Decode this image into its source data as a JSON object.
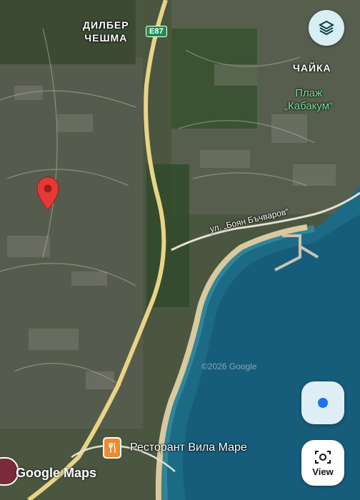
{
  "map": {
    "places": {
      "dilber_cheshma": "ДИЛБЕР\nЧЕШМА",
      "chaika": "ЧАЙКА",
      "beach_kabakum": "Плаж\n„Кабакум“"
    },
    "road_shield": "E87",
    "street": "ул. „Боян Бъчваров“",
    "poi": {
      "label": "Ресторант Вила Маре",
      "icon": "restaurant-icon"
    },
    "copyright": "©2026 Google",
    "logo": "Google Maps",
    "pin": "location-pin-icon"
  },
  "controls": {
    "layers_icon": "layers-icon",
    "my_location_icon": "my-location-icon",
    "view_label": "View",
    "view_icon": "lens-camera-icon"
  },
  "colors": {
    "pin": "#e53935",
    "sea": "#1d6a86",
    "beach_label": "#7fe39a",
    "road": "#e8d487",
    "location_dot": "#1a73e8",
    "poi": "#f08a2e"
  }
}
